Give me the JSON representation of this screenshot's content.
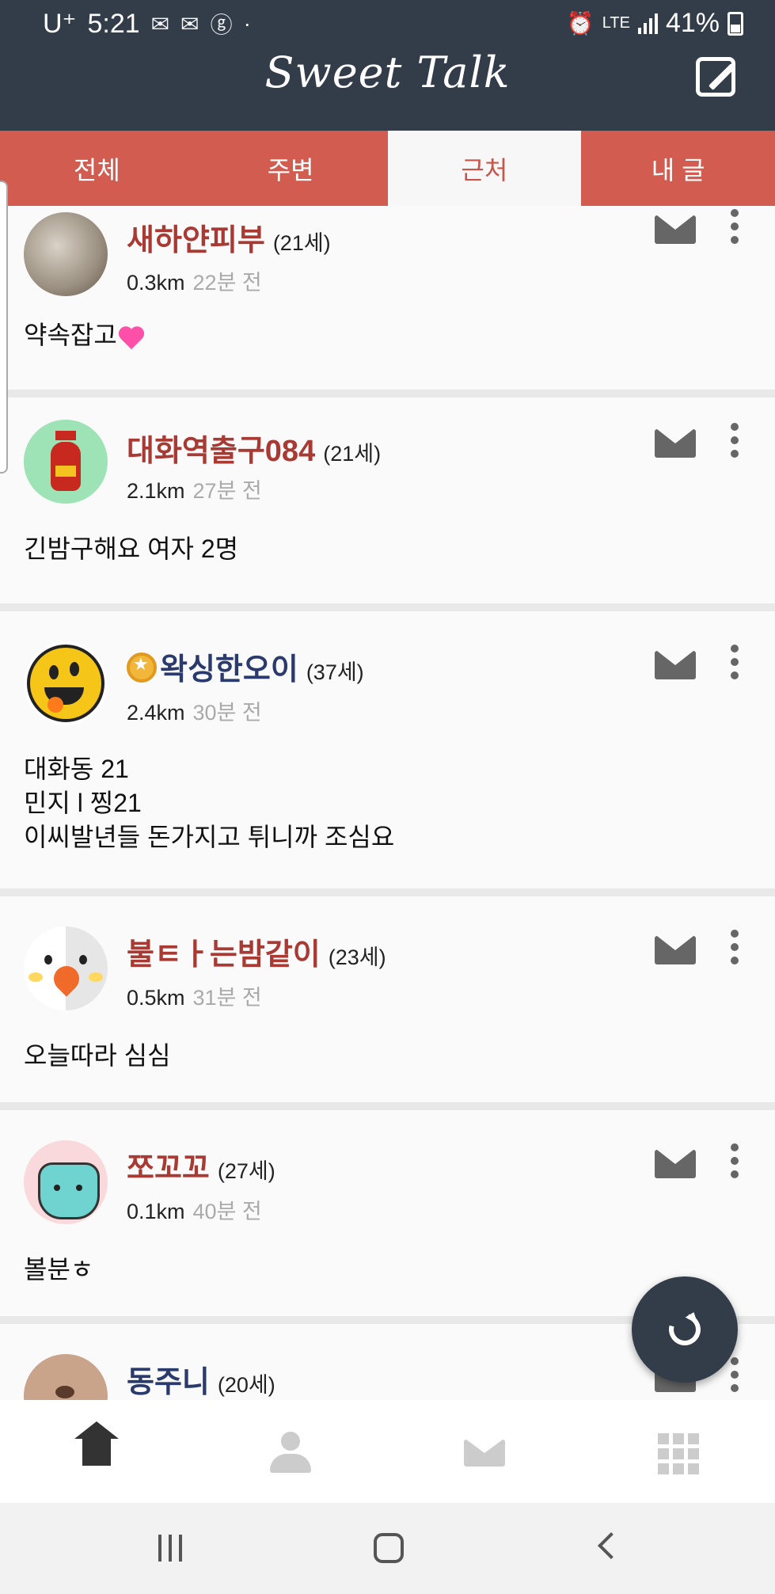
{
  "status_bar": {
    "carrier": "U⁺",
    "time": "5:21",
    "network": "LTE",
    "battery": "41%"
  },
  "header": {
    "title": "Sweet Talk"
  },
  "tabs": [
    {
      "label": "전체",
      "active": false
    },
    {
      "label": "주변",
      "active": false
    },
    {
      "label": "근처",
      "active": true
    },
    {
      "label": "내 글",
      "active": false
    }
  ],
  "posts": [
    {
      "nickname": "새하얀피부",
      "age": "(21세)",
      "distance": "0.3km",
      "time": "22분 전",
      "message": "약속잡고",
      "nick_color": "red"
    },
    {
      "nickname": "대화역출구084",
      "age": "(21세)",
      "distance": "2.1km",
      "time": "27분 전",
      "message": "긴밤구해요 여자 2명",
      "nick_color": "red"
    },
    {
      "nickname": "왁싱한오이",
      "age": "(37세)",
      "distance": "2.4km",
      "time": "30분 전",
      "message": "대화동 21\n민지 l 찡21\n이씨발년들 돈가지고 튀니까 조심요",
      "nick_color": "blue"
    },
    {
      "nickname": "불ㅌㅏ는밤같이",
      "age": "(23세)",
      "distance": "0.5km",
      "time": "31분 전",
      "message": "오늘따라 심심",
      "nick_color": "red"
    },
    {
      "nickname": "쪼꼬꼬",
      "age": "(27세)",
      "distance": "0.1km",
      "time": "40분 전",
      "message": "볼분ㅎ",
      "nick_color": "red"
    },
    {
      "nickname": "동주니",
      "age": "(20세)",
      "distance": "",
      "time": "",
      "message": "",
      "nick_color": "blue"
    }
  ],
  "icons": {
    "header": "compose-icon",
    "post_actions": [
      "mail-icon",
      "more-vert-icon"
    ],
    "fab": "refresh-icon",
    "bottom_nav": [
      "home-icon",
      "profile-icon",
      "mail-icon",
      "apps-icon"
    ]
  },
  "colors": {
    "header_bg": "#333d4a",
    "tab_bg": "#d25c50",
    "nick_red": "#a83a33",
    "nick_blue": "#2a3a6c"
  }
}
